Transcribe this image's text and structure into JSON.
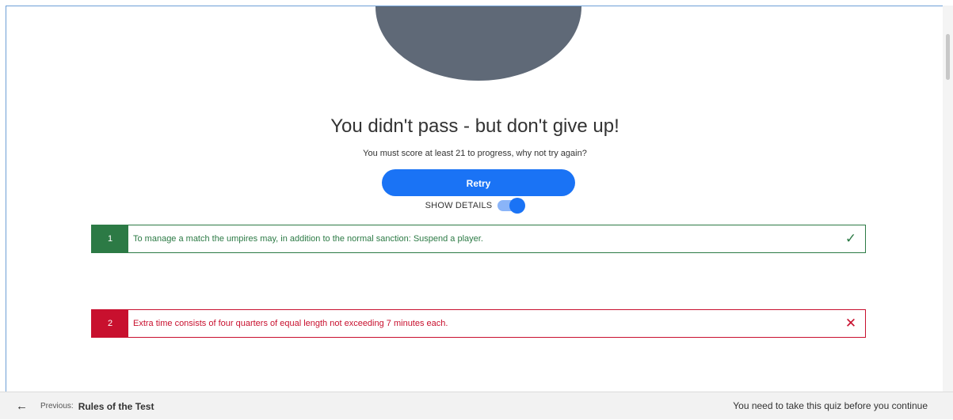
{
  "result": {
    "title": "You didn't pass - but don't give up!",
    "subtitle": "You must score at least 21 to progress, why not try again?",
    "retry_label": "Retry",
    "show_details_label": "SHOW DETAILS",
    "show_details_on": true
  },
  "questions": [
    {
      "number": "1",
      "text": "To manage a match the umpires may, in addition to the normal sanction: Suspend a player.",
      "status": "correct",
      "mark": "✓"
    },
    {
      "number": "2",
      "text": "Extra time consists of four quarters of equal length not exceeding 7 minutes each.",
      "status": "incorrect",
      "mark": "✕"
    }
  ],
  "footer": {
    "previous_label": "Previous:",
    "previous_title": "Rules of the Test",
    "note": "You need to take this quiz before you continue"
  },
  "colors": {
    "accent": "#1a73f5",
    "correct": "#2c7a45",
    "incorrect": "#c8102e",
    "avatar": "#5f6977"
  },
  "icons": {
    "correct": "check-icon",
    "incorrect": "cross-icon",
    "previous": "arrow-left-icon"
  }
}
